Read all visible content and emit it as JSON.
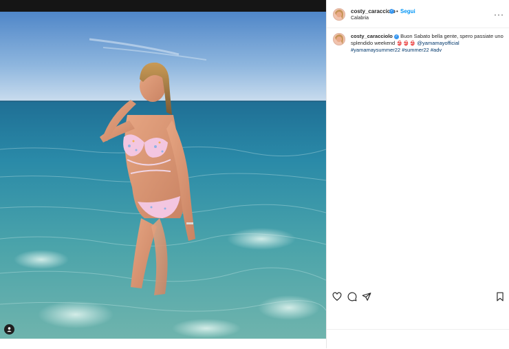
{
  "post": {
    "username": "costy_caracciolo",
    "separator": "•",
    "follow_label": "Segui",
    "location": "Calabria",
    "more_icon": "more-horizontal-icon",
    "caption": {
      "username": "costy_caracciolo",
      "text_before": "Buon Sabato bella gente, spero passiate uno splendido weekend",
      "emojis": "👙👙👙",
      "mention": "@yamamayofficial",
      "hashtags": "#yamamaysummer22 #summer22 #adv"
    }
  },
  "actions": {
    "like_icon": "heart-icon",
    "comment_icon": "comment-icon",
    "share_icon": "send-icon",
    "save_icon": "bookmark-icon"
  },
  "colors": {
    "accent": "#0095f6",
    "verified": "#3897f0",
    "text": "#262626"
  }
}
